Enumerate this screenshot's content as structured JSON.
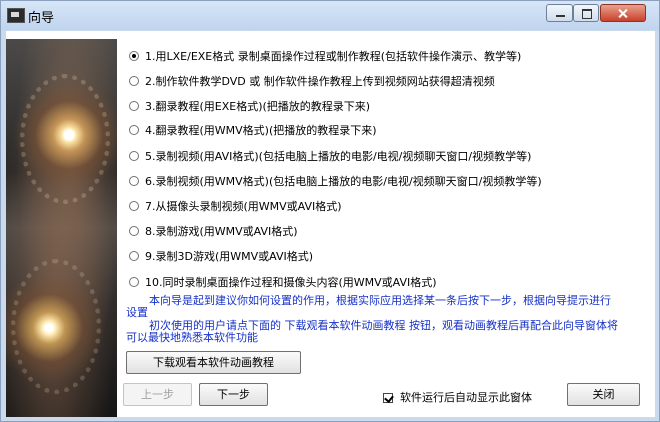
{
  "window": {
    "title": "向导"
  },
  "options": [
    "1.用LXE/EXE格式 录制桌面操作过程或制作教程(包括软件操作演示、教学等)",
    "2.制作软件教学DVD 或 制作软件操作教程上传到视频网站获得超清视频",
    "3.翻录教程(用EXE格式)(把播放的教程录下来)",
    "4.翻录教程(用WMV格式)(把播放的教程录下来)",
    "5.录制视频(用AVI格式)(包括电脑上播放的电影/电视/视频聊天窗口/视频教学等)",
    "6.录制视频(用WMV格式)(包括电脑上播放的电影/电视/视频聊天窗口/视频教学等)",
    "7.从摄像头录制视频(用WMV或AVI格式)",
    "8.录制游戏(用WMV或AVI格式)",
    "9.录制3D游戏(用WMV或AVI格式)",
    "10.同时录制桌面操作过程和摄像头内容(用WMV或AVI格式)"
  ],
  "help": {
    "line1": "本向导是起到建议你如何设置的作用，根据实际应用选择某一条后按下一步，根据向导提示进行设置",
    "line2": "初次使用的用户请点下面的 下载观看本软件动画教程 按钮，观看动画教程后再配合此向导窗体将可以最快地熟悉本软件功能"
  },
  "buttons": {
    "watch": "下载观看本软件动画教程",
    "prev": "上一步",
    "next": "下一步",
    "close": "关闭"
  },
  "checkbox": {
    "label": "软件运行后自动显示此窗体",
    "checked": true
  }
}
